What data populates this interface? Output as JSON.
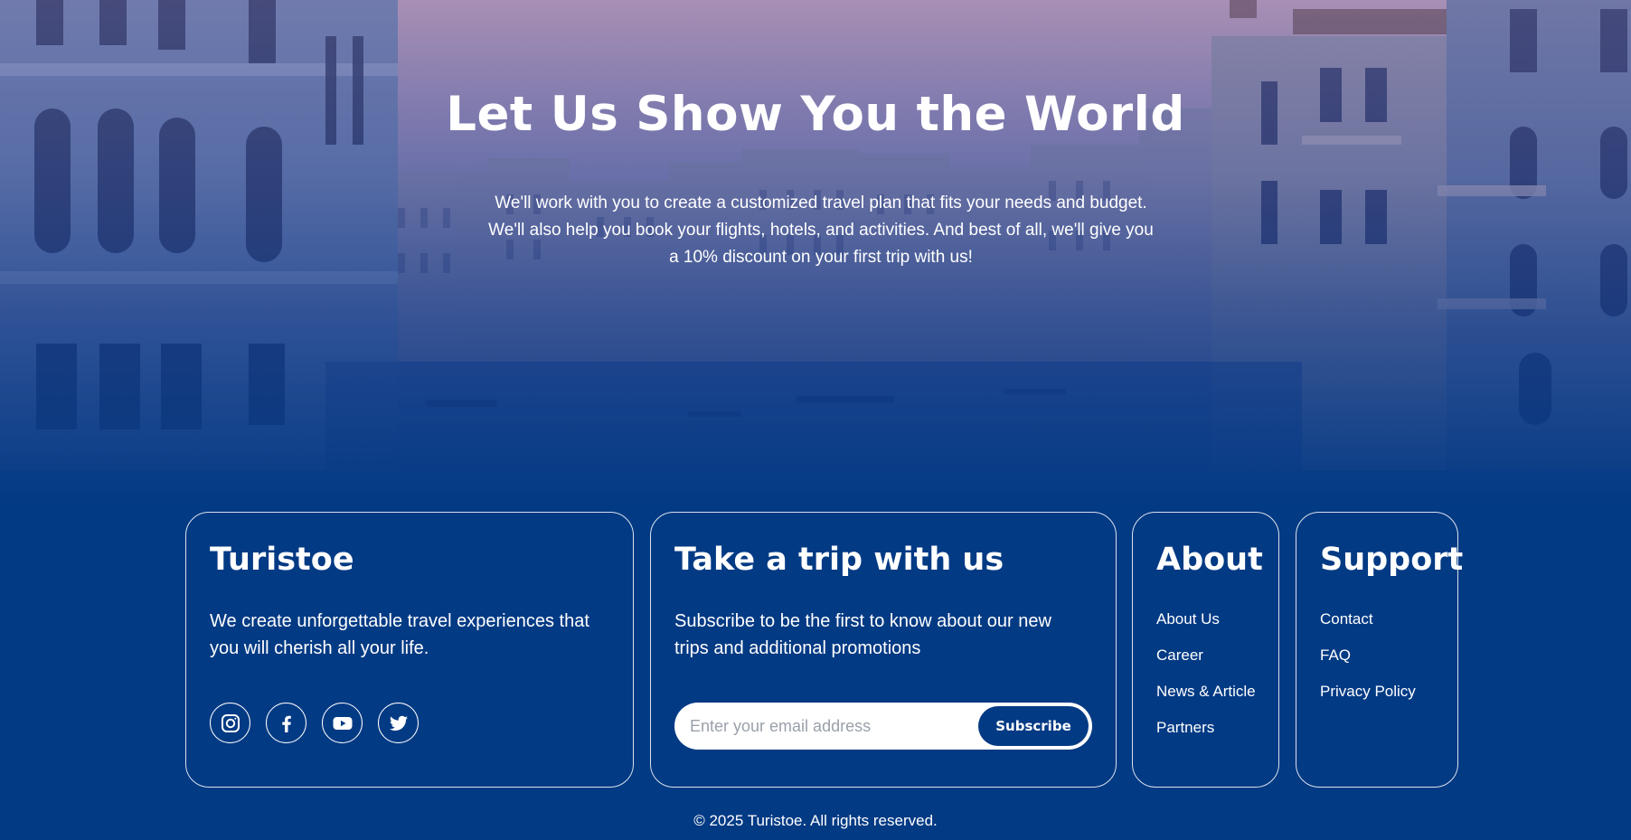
{
  "hero": {
    "title": "Let Us Show You the World",
    "description": "We'll work with you to create a customized travel plan that fits your needs and budget. We'll also help you book your flights, hotels, and activities. And best of all, we'll give you a 10% discount on your first trip with us!"
  },
  "brand": {
    "name": "Turistoe",
    "description": "We create unforgettable travel experiences that you will cherish all your life.",
    "socials": [
      {
        "icon": "instagram-icon"
      },
      {
        "icon": "facebook-icon"
      },
      {
        "icon": "youtube-icon"
      },
      {
        "icon": "twitter-icon"
      }
    ]
  },
  "trip": {
    "title": "Take a trip with us",
    "description": "Subscribe to be the first to know about our new trips and additional promotions",
    "email_placeholder": "Enter your email address",
    "email_value": "",
    "subscribe_label": "Subscribe"
  },
  "about": {
    "title": "About",
    "links": [
      "About Us",
      "Career",
      "News & Article",
      "Partners"
    ]
  },
  "support": {
    "title": "Support",
    "links": [
      "Contact",
      "FAQ",
      "Privacy Policy"
    ]
  },
  "footer": {
    "copyright": "© 2025 Turistoe. All rights reserved."
  },
  "colors": {
    "primary": "#033a84",
    "text": "#ffffff",
    "input_background": "#ffffff"
  }
}
